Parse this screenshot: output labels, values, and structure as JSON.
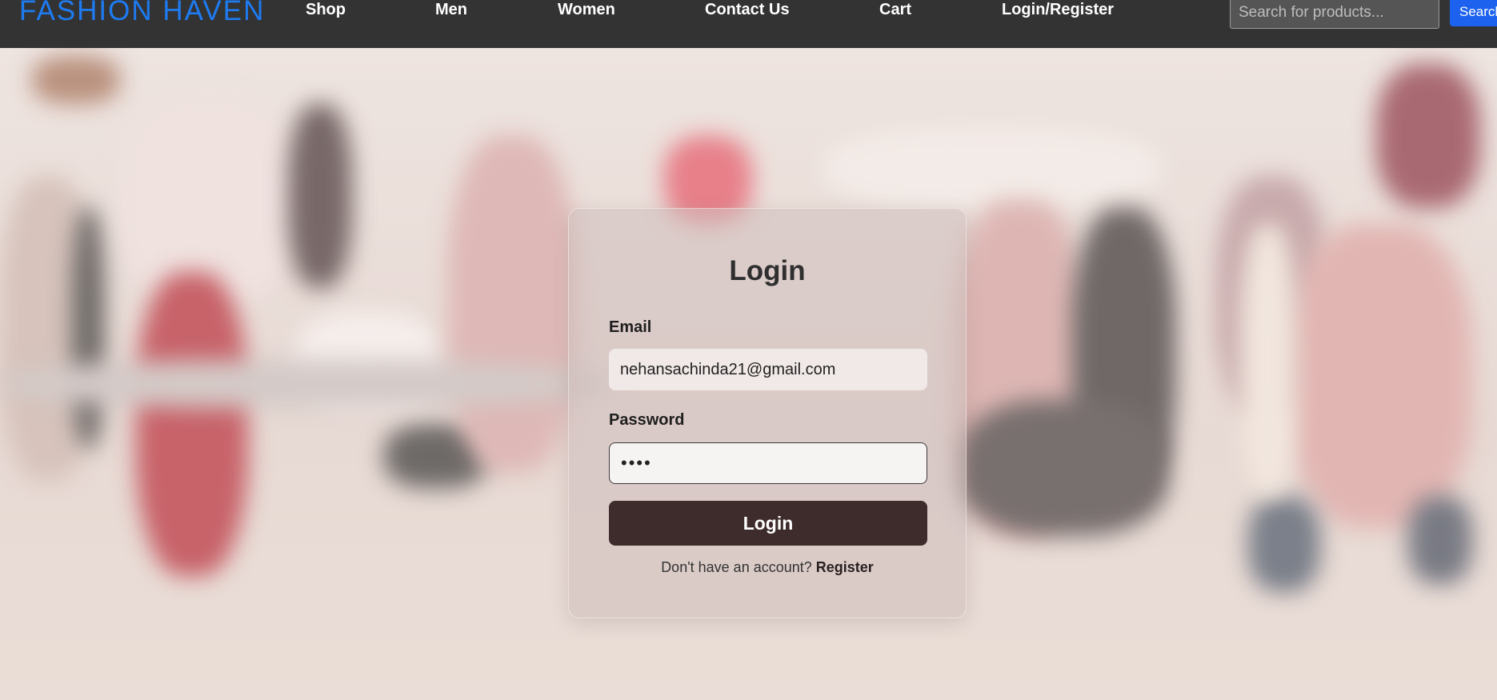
{
  "header": {
    "brand": "FASHION HAVEN",
    "nav": {
      "shop": "Shop",
      "men": "Men",
      "women": "Women",
      "contact": "Contact Us",
      "cart": "Cart",
      "login_register": "Login/Register"
    },
    "search": {
      "placeholder": "Search for products...",
      "value": "",
      "button_label": "Search"
    }
  },
  "login": {
    "title": "Login",
    "email_label": "Email",
    "email_value": "nehansachinda21@gmail.com",
    "password_label": "Password",
    "password_value": "••••",
    "submit_label": "Login",
    "register_prompt": "Don't have an account?",
    "register_link": "Register"
  },
  "colors": {
    "navbar_bg": "#333333",
    "brand": "#1e7bf2",
    "search_button": "#1d62ef",
    "login_button": "#3e2b2b"
  }
}
